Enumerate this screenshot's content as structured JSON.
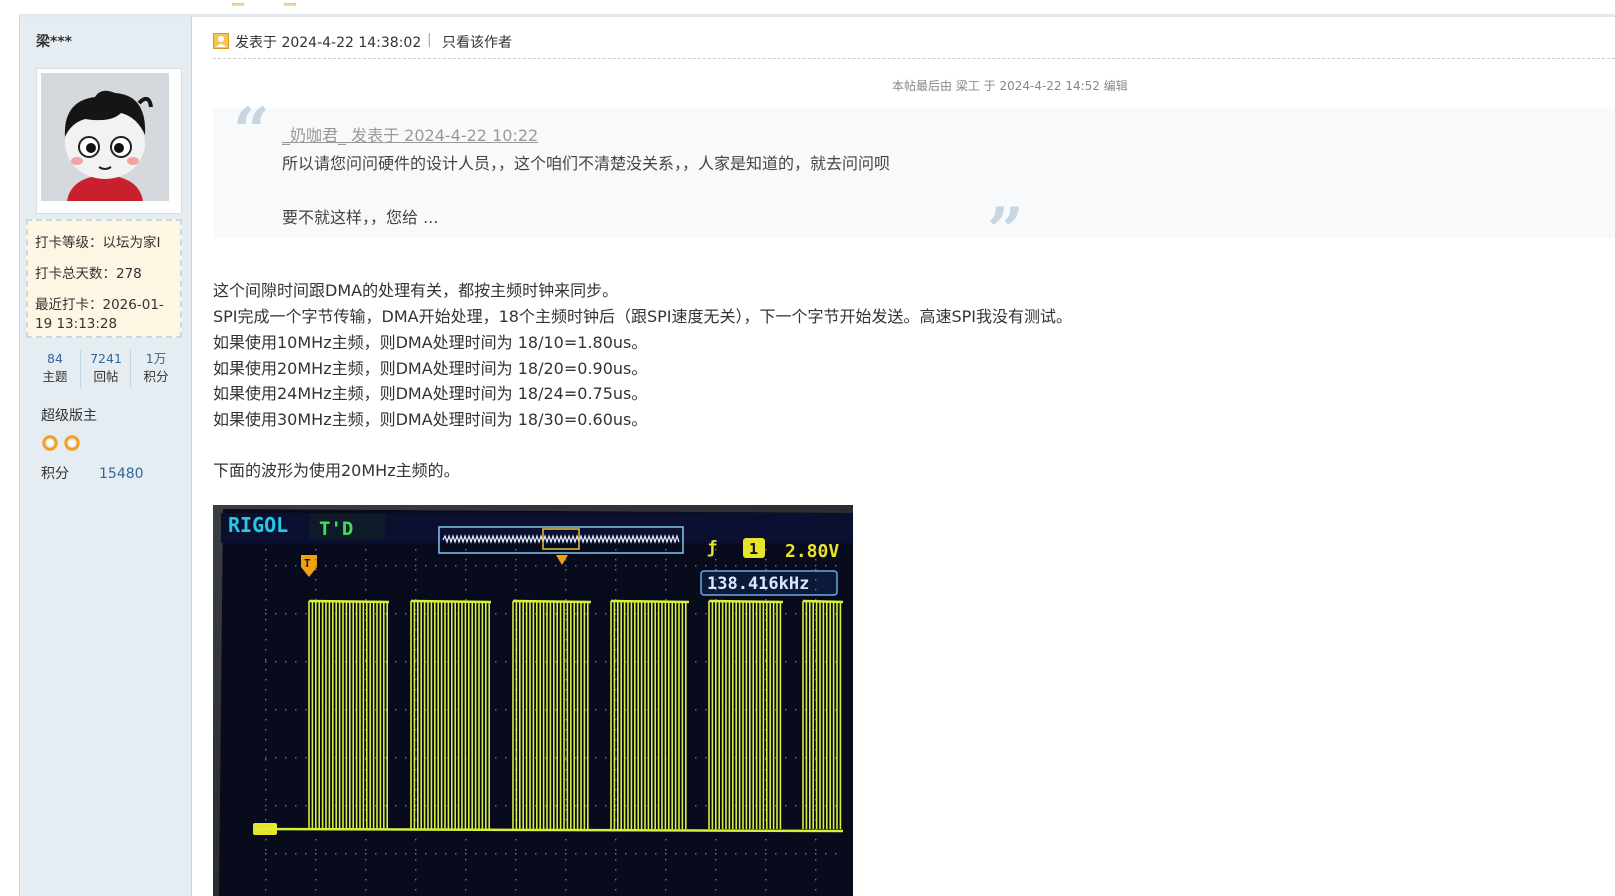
{
  "sidebar": {
    "username": "梁***",
    "checkin": {
      "level": "打卡等级：以坛为家I",
      "total_days": "打卡总天数：278",
      "recent_line1": "最近打卡：2026-01-",
      "recent_line2": "19 13:13:28"
    },
    "stats": [
      {
        "value": "84",
        "label": "主题"
      },
      {
        "value": "7241",
        "label": "回帖"
      },
      {
        "value": "1万",
        "label": "积分"
      }
    ],
    "rank": "超级版主",
    "score_label": "积分",
    "score_value": "15480"
  },
  "post": {
    "posted": "发表于 2024-4-22 14:38:02",
    "separator": "|",
    "author_only": "只看该作者",
    "edit_note": "本帖最后由 梁工 于 2024-4-22 14:52 编辑",
    "quote": {
      "ref": "_奶咖君_ 发表于 2024-4-22 10:22",
      "line1": "所以请您问问硬件的设计人员，，这个咱们不清楚没关系，，人家是知道的，就去问问呗",
      "line2": "要不就这样，，您给 ..."
    },
    "body": [
      "这个间隙时间跟DMA的处理有关，都按主频时钟来同步。",
      "SPI完成一个字节传输，DMA开始处理，18个主频时钟后（跟SPI速度无关），下一个字节开始发送。高速SPI我没有测试。",
      "如果使用10MHz主频，则DMA处理时间为 18/10=1.80us。",
      "如果使用20MHz主频，则DMA处理时间为 18/20=0.90us。",
      "如果使用24MHz主频，则DMA处理时间为 18/24=0.75us。",
      "如果使用30MHz主频，则DMA处理时间为 18/30=0.60us。",
      "下面的波形为使用20MHz主频的。"
    ],
    "scope": {
      "brand": "RIGOL",
      "mode": "T'D",
      "trigger_level": "2.80V",
      "frequency": "138.416kHz",
      "trigger_marker": "T",
      "channel_marker": "1"
    }
  },
  "colors": {
    "sidebar_bg": "#e5edf2",
    "checkin_bg": "#fdf6e3",
    "link_blue": "#336699",
    "waveform": "#d8f03a",
    "scope_text_cyan": "#25c9e6",
    "scope_text_yellow": "#e8e42a"
  },
  "icons": {
    "post_icon": "user-card-icon",
    "medal_icon": "gear-medal-icon"
  }
}
